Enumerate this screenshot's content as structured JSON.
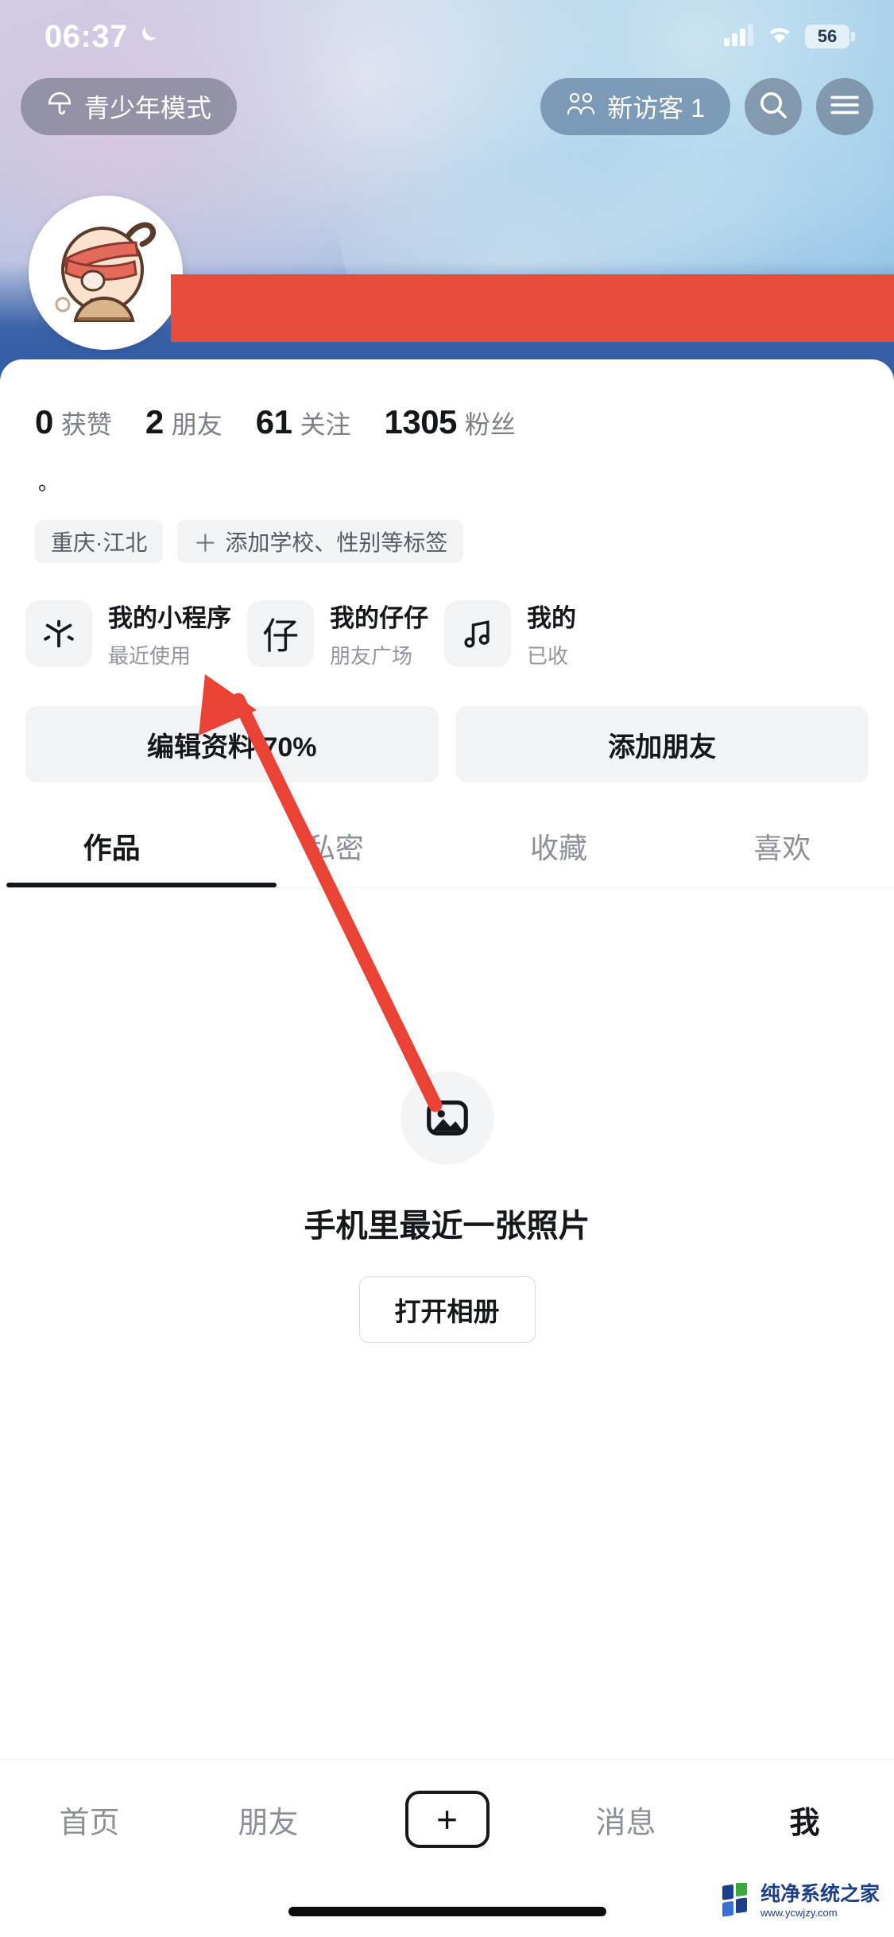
{
  "status_bar": {
    "time": "06:37",
    "moon_icon": "crescent-moon-icon",
    "signal_icon": "cellular-signal-icon",
    "wifi_icon": "wifi-icon",
    "battery_level": "56"
  },
  "top_bar": {
    "teen_mode_label": "青少年模式",
    "teen_mode_icon": "umbrella-icon",
    "visitor_label": "新访客 1",
    "visitor_icon": "people-icon",
    "search_icon": "search-icon",
    "menu_icon": "hamburger-menu-icon"
  },
  "profile": {
    "avatar_icon": "cartoon-avatar",
    "live_dot_icon": "status-dot-icon",
    "expand_icon": "chevron-down-icon",
    "bio": "。",
    "stats": [
      {
        "num": "0",
        "label": "获赞"
      },
      {
        "num": "2",
        "label": "朋友"
      },
      {
        "num": "61",
        "label": "关注"
      },
      {
        "num": "1305",
        "label": "粉丝"
      }
    ],
    "tags": [
      {
        "text": "重庆·江北",
        "has_plus": false
      },
      {
        "text": "添加学校、性别等标签",
        "has_plus": true
      }
    ]
  },
  "entry_cards": [
    {
      "icon": "asterisk-icon",
      "icon_char": "",
      "title": "我的小程序",
      "subtitle": "最近使用"
    },
    {
      "icon": "zi-character-icon",
      "icon_char": "仔",
      "title": "我的仔仔",
      "subtitle": "朋友广场"
    },
    {
      "icon": "music-note-icon",
      "icon_char": "",
      "title": "我的",
      "subtitle": "已收"
    }
  ],
  "actions": {
    "edit_profile": "编辑资料 70%",
    "add_friend": "添加朋友"
  },
  "tabs": [
    {
      "label": "作品",
      "active": true
    },
    {
      "label": "私密",
      "active": false
    },
    {
      "label": "收藏",
      "active": false
    },
    {
      "label": "喜欢",
      "active": false
    }
  ],
  "empty_state": {
    "icon": "image-placeholder-icon",
    "title": "手机里最近一张照片",
    "button_label": "打开相册"
  },
  "bottom_nav": {
    "items": [
      {
        "label": "首页",
        "active": false
      },
      {
        "label": "朋友",
        "active": false
      },
      {
        "label": "消息",
        "active": false
      },
      {
        "label": "我",
        "active": true
      }
    ],
    "plus_icon": "plus-icon",
    "plus_char": "+"
  },
  "annotation": {
    "arrow_icon": "red-pointer-arrow",
    "arrow_color": "#ea4335"
  },
  "watermark": {
    "name": "纯净系统之家",
    "url": "www.ycwjzy.com"
  },
  "colors": {
    "accent_red": "#e84c3b",
    "text_primary": "#14171c",
    "text_muted": "#8b9099",
    "chip_bg": "#f2f3f5"
  }
}
